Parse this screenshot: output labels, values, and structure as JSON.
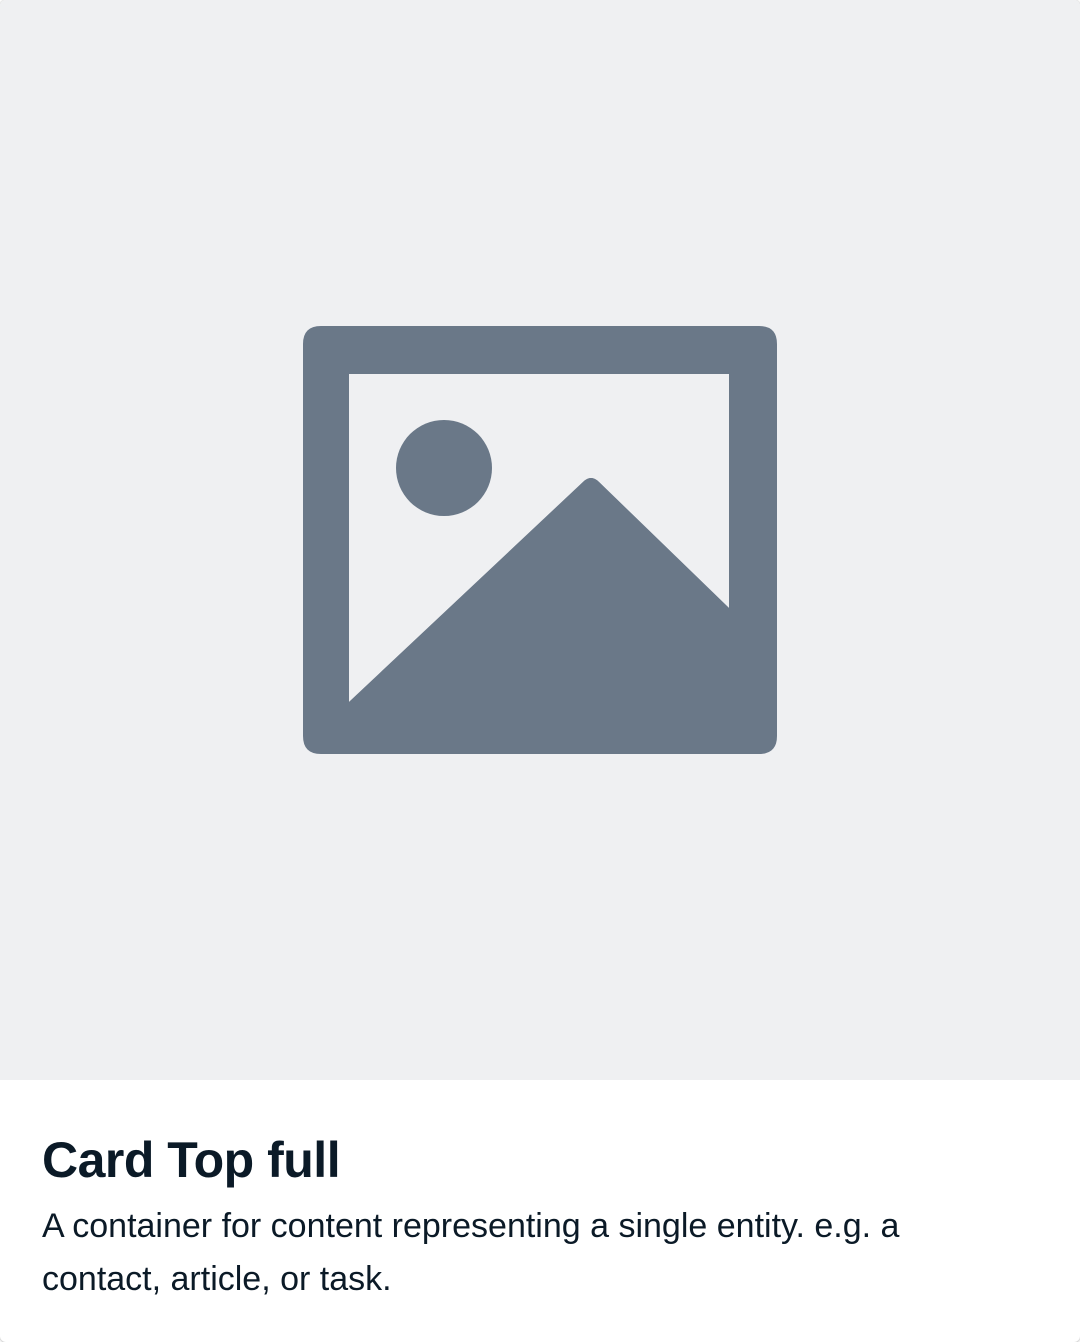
{
  "card": {
    "image": {
      "icon": "image-placeholder-icon",
      "background_color": "#eff0f2",
      "icon_color": "#6a7888"
    },
    "title": "Card Top full",
    "description": "A container for content representing a single entity. e.g. a contact, article, or task."
  }
}
